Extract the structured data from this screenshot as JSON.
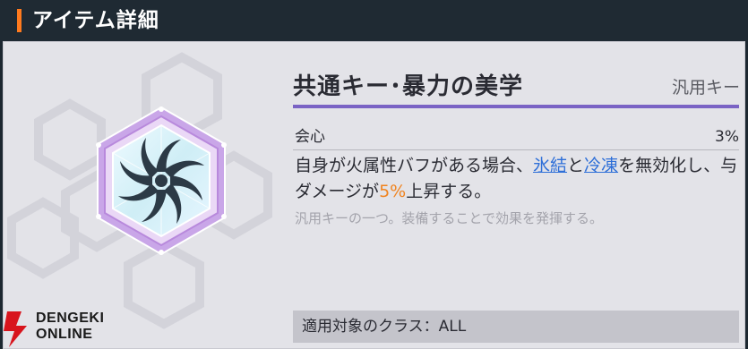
{
  "header": {
    "title": "アイテム詳細"
  },
  "item": {
    "name": "共通キー･暴力の美学",
    "category": "汎用キー",
    "icon": "blade-pinwheel-icon",
    "stat": {
      "label": "会心",
      "value": "3%"
    },
    "effect": {
      "t1": "自身が火属性バフがある場合、",
      "k1": "氷結",
      "t2": "と",
      "k2": "冷凍",
      "t3": "を無効化し、与ダメージが",
      "hl": "5%",
      "t4": "上昇する。"
    },
    "flavor": "汎用キーの一つ。装備することで効果を発揮する。",
    "target": "適用対象のクラス：ALL"
  },
  "watermark": {
    "line1": "DENGEKI",
    "line2": "ONLINE"
  },
  "colors": {
    "accent": "#ff7a1e",
    "rule": "#7a63c4",
    "keyword": "#2e6fd8",
    "highlight": "#f08420"
  }
}
